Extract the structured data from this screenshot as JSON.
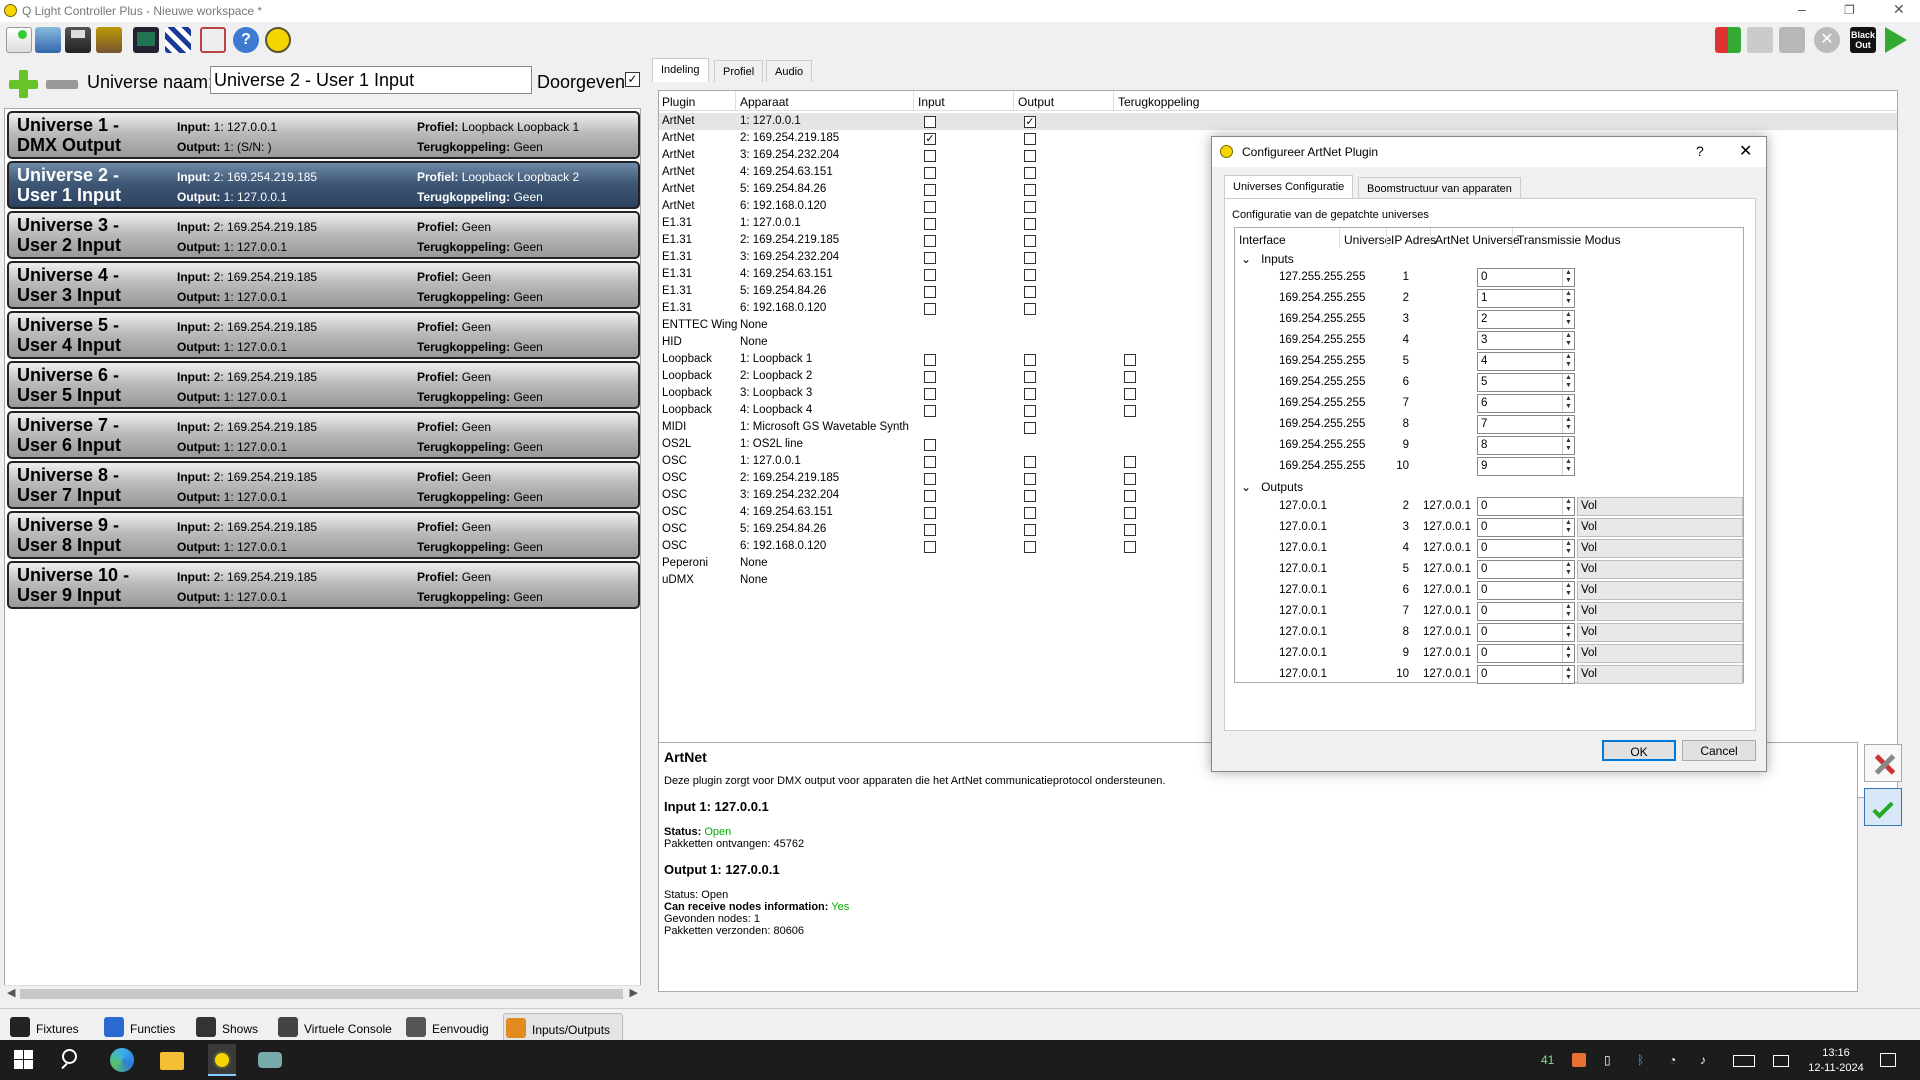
{
  "window": {
    "title": "Q Light Controller Plus - Nieuwe workspace *"
  },
  "toolbar": {
    "left_icons": [
      "new-workspace-icon",
      "open-workspace-icon",
      "save-workspace-icon",
      "save-as-icon",
      "monitor-icon",
      "address-tool-icon",
      "fullscreen-icon",
      "help-icon",
      "about-icon"
    ],
    "right_icons": [
      "fixture-remap-icon",
      "stop-functions-icon",
      "fade-icon",
      "stop-icon",
      "blackout-icon",
      "mode-icon"
    ],
    "blackout_label": "Black Out"
  },
  "universe_panel": {
    "name_label": "Universe naam:",
    "name_value": "Universe 2 - User 1 Input",
    "passthrough_label": "Doorgeven",
    "passthrough_checked": true,
    "input_key": "Input:",
    "output_key": "Output:",
    "profile_key": "Profiel:",
    "feedback_key": "Terugkoppeling:",
    "universes": [
      {
        "name": "Universe 1 -\nDMX Output",
        "l1": "Universe 1 -",
        "l2": "DMX Output",
        "input": "1: 127.0.0.1",
        "output": "1:  (S/N: )",
        "profile": "Loopback Loopback 1",
        "feedback": "Geen",
        "selected": false
      },
      {
        "l1": "Universe 2 -",
        "l2": "User 1 Input",
        "input": "2: 169.254.219.185",
        "output": "1: 127.0.0.1",
        "profile": "Loopback Loopback 2",
        "feedback": "Geen",
        "selected": true
      },
      {
        "l1": "Universe 3  -",
        "l2": "User 2 Input",
        "input": "2: 169.254.219.185",
        "output": "1: 127.0.0.1",
        "profile": "Geen",
        "feedback": "Geen",
        "selected": false
      },
      {
        "l1": "Universe 4 -",
        "l2": "User 3 Input",
        "input": "2: 169.254.219.185",
        "output": "1: 127.0.0.1",
        "profile": "Geen",
        "feedback": "Geen",
        "selected": false
      },
      {
        "l1": "Universe 5 -",
        "l2": "User 4 Input",
        "input": "2: 169.254.219.185",
        "output": "1: 127.0.0.1",
        "profile": "Geen",
        "feedback": "Geen",
        "selected": false
      },
      {
        "l1": "Universe 6 -",
        "l2": "User 5 Input",
        "input": "2: 169.254.219.185",
        "output": "1: 127.0.0.1",
        "profile": "Geen",
        "feedback": "Geen",
        "selected": false
      },
      {
        "l1": "Universe 7 -",
        "l2": "User 6 Input",
        "input": "2: 169.254.219.185",
        "output": "1: 127.0.0.1",
        "profile": "Geen",
        "feedback": "Geen",
        "selected": false
      },
      {
        "l1": "Universe 8 -",
        "l2": "User 7 Input",
        "input": "2: 169.254.219.185",
        "output": "1: 127.0.0.1",
        "profile": "Geen",
        "feedback": "Geen",
        "selected": false
      },
      {
        "l1": "Universe 9 -",
        "l2": "User 8 Input",
        "input": "2: 169.254.219.185",
        "output": "1: 127.0.0.1",
        "profile": "Geen",
        "feedback": "Geen",
        "selected": false
      },
      {
        "l1": "Universe 10 -",
        "l2": "User 9 Input",
        "input": "2: 169.254.219.185",
        "output": "1: 127.0.0.1",
        "profile": "Geen",
        "feedback": "Geen",
        "selected": false
      }
    ]
  },
  "io_tabs": [
    "Indeling",
    "Profiel",
    "Audio"
  ],
  "io_table": {
    "headers": [
      "Plugin",
      "Apparaat",
      "Input",
      "Output",
      "Terugkoppeling"
    ],
    "rows": [
      {
        "plugin": "ArtNet",
        "device": "1: 127.0.0.1",
        "input": false,
        "output": true,
        "feedback": null,
        "selected": true
      },
      {
        "plugin": "ArtNet",
        "device": "2: 169.254.219.185",
        "input": true,
        "output": false,
        "feedback": null
      },
      {
        "plugin": "ArtNet",
        "device": "3: 169.254.232.204",
        "input": false,
        "output": false,
        "feedback": null
      },
      {
        "plugin": "ArtNet",
        "device": "4: 169.254.63.151",
        "input": false,
        "output": false,
        "feedback": null
      },
      {
        "plugin": "ArtNet",
        "device": "5: 169.254.84.26",
        "input": false,
        "output": false,
        "feedback": null
      },
      {
        "plugin": "ArtNet",
        "device": "6: 192.168.0.120",
        "input": false,
        "output": false,
        "feedback": null
      },
      {
        "plugin": "E1.31",
        "device": "1: 127.0.0.1",
        "input": false,
        "output": false,
        "feedback": null
      },
      {
        "plugin": "E1.31",
        "device": "2: 169.254.219.185",
        "input": false,
        "output": false,
        "feedback": null
      },
      {
        "plugin": "E1.31",
        "device": "3: 169.254.232.204",
        "input": false,
        "output": false,
        "feedback": null
      },
      {
        "plugin": "E1.31",
        "device": "4: 169.254.63.151",
        "input": false,
        "output": false,
        "feedback": null
      },
      {
        "plugin": "E1.31",
        "device": "5: 169.254.84.26",
        "input": false,
        "output": false,
        "feedback": null
      },
      {
        "plugin": "E1.31",
        "device": "6: 192.168.0.120",
        "input": false,
        "output": false,
        "feedback": null
      },
      {
        "plugin": "ENTTEC Wing",
        "device": "None",
        "input": null,
        "output": null,
        "feedback": null
      },
      {
        "plugin": "HID",
        "device": "None",
        "input": null,
        "output": null,
        "feedback": null
      },
      {
        "plugin": "Loopback",
        "device": "1: Loopback 1",
        "input": false,
        "output": false,
        "feedback": false
      },
      {
        "plugin": "Loopback",
        "device": "2: Loopback 2",
        "input": false,
        "output": false,
        "feedback": false
      },
      {
        "plugin": "Loopback",
        "device": "3: Loopback 3",
        "input": false,
        "output": false,
        "feedback": false
      },
      {
        "plugin": "Loopback",
        "device": "4: Loopback 4",
        "input": false,
        "output": false,
        "feedback": false
      },
      {
        "plugin": "MIDI",
        "device": "1: Microsoft GS Wavetable Synth",
        "input": null,
        "output": false,
        "feedback": null
      },
      {
        "plugin": "OS2L",
        "device": "1: OS2L line",
        "input": false,
        "output": null,
        "feedback": null
      },
      {
        "plugin": "OSC",
        "device": "1: 127.0.0.1",
        "input": false,
        "output": false,
        "feedback": false
      },
      {
        "plugin": "OSC",
        "device": "2: 169.254.219.185",
        "input": false,
        "output": false,
        "feedback": false
      },
      {
        "plugin": "OSC",
        "device": "3: 169.254.232.204",
        "input": false,
        "output": false,
        "feedback": false
      },
      {
        "plugin": "OSC",
        "device": "4: 169.254.63.151",
        "input": false,
        "output": false,
        "feedback": false
      },
      {
        "plugin": "OSC",
        "device": "5: 169.254.84.26",
        "input": false,
        "output": false,
        "feedback": false
      },
      {
        "plugin": "OSC",
        "device": "6: 192.168.0.120",
        "input": false,
        "output": false,
        "feedback": false
      },
      {
        "plugin": "Peperoni",
        "device": "None",
        "input": null,
        "output": null,
        "feedback": null
      },
      {
        "plugin": "uDMX",
        "device": "None",
        "input": null,
        "output": null,
        "feedback": null
      }
    ]
  },
  "info": {
    "title": "ArtNet",
    "description": "Deze plugin zorgt voor DMX output voor apparaten die het ArtNet communicatieprotocol ondersteunen.",
    "input_heading": "Input 1: 127.0.0.1",
    "status_label": "Status:",
    "input_status": "Open",
    "packets_received": "Pakketten ontvangen: 45762",
    "output_heading": "Output 1: 127.0.0.1",
    "output_status": "Status: Open",
    "nodes_info_label": "Can receive nodes information:",
    "nodes_info_value": "Yes",
    "nodes_found": "Gevonden nodes: 1",
    "packets_sent": "Pakketten verzonden: 80606"
  },
  "dialog": {
    "title": "Configureer ArtNet Plugin",
    "help": "?",
    "close": "✕",
    "tabs": [
      "Universes Configuratie",
      "Boomstructuur van apparaten"
    ],
    "description": "Configuratie van de gepatchte universes",
    "headers": [
      "Interface",
      "Universe",
      "IP Adres",
      "ArtNet Universe",
      "Transmissie Modus"
    ],
    "inputs_label": "Inputs",
    "outputs_label": "Outputs",
    "inputs": [
      {
        "iface": "127.255.255.255",
        "univ": "1",
        "artnet": "0"
      },
      {
        "iface": "169.254.255.255",
        "univ": "2",
        "artnet": "1"
      },
      {
        "iface": "169.254.255.255",
        "univ": "3",
        "artnet": "2"
      },
      {
        "iface": "169.254.255.255",
        "univ": "4",
        "artnet": "3"
      },
      {
        "iface": "169.254.255.255",
        "univ": "5",
        "artnet": "4"
      },
      {
        "iface": "169.254.255.255",
        "univ": "6",
        "artnet": "5"
      },
      {
        "iface": "169.254.255.255",
        "univ": "7",
        "artnet": "6"
      },
      {
        "iface": "169.254.255.255",
        "univ": "8",
        "artnet": "7"
      },
      {
        "iface": "169.254.255.255",
        "univ": "9",
        "artnet": "8"
      },
      {
        "iface": "169.254.255.255",
        "univ": "10",
        "artnet": "9"
      }
    ],
    "outputs": [
      {
        "iface": "127.0.0.1",
        "univ": "2",
        "ip": "127.0.0.1",
        "artnet": "0",
        "mode": "Vol"
      },
      {
        "iface": "127.0.0.1",
        "univ": "3",
        "ip": "127.0.0.1",
        "artnet": "0",
        "mode": "Vol"
      },
      {
        "iface": "127.0.0.1",
        "univ": "4",
        "ip": "127.0.0.1",
        "artnet": "0",
        "mode": "Vol"
      },
      {
        "iface": "127.0.0.1",
        "univ": "5",
        "ip": "127.0.0.1",
        "artnet": "0",
        "mode": "Vol"
      },
      {
        "iface": "127.0.0.1",
        "univ": "6",
        "ip": "127.0.0.1",
        "artnet": "0",
        "mode": "Vol"
      },
      {
        "iface": "127.0.0.1",
        "univ": "7",
        "ip": "127.0.0.1",
        "artnet": "0",
        "mode": "Vol"
      },
      {
        "iface": "127.0.0.1",
        "univ": "8",
        "ip": "127.0.0.1",
        "artnet": "0",
        "mode": "Vol"
      },
      {
        "iface": "127.0.0.1",
        "univ": "9",
        "ip": "127.0.0.1",
        "artnet": "0",
        "mode": "Vol"
      },
      {
        "iface": "127.0.0.1",
        "univ": "10",
        "ip": "127.0.0.1",
        "artnet": "0",
        "mode": "Vol"
      }
    ],
    "ok_label": "OK",
    "cancel_label": "Cancel"
  },
  "bottom_tabs": [
    {
      "label": "Fixtures",
      "icon": "fixtures-icon"
    },
    {
      "label": "Functies",
      "icon": "functions-icon"
    },
    {
      "label": "Shows",
      "icon": "shows-icon"
    },
    {
      "label": "Virtuele Console",
      "icon": "virtual-console-icon"
    },
    {
      "label": "Eenvoudig",
      "icon": "simple-desk-icon"
    },
    {
      "label": "Inputs/Outputs",
      "icon": "inputs-outputs-icon",
      "active": true
    }
  ],
  "taskbar": {
    "tray_number": "41",
    "time": "13:16",
    "date": "12-11-2024"
  }
}
